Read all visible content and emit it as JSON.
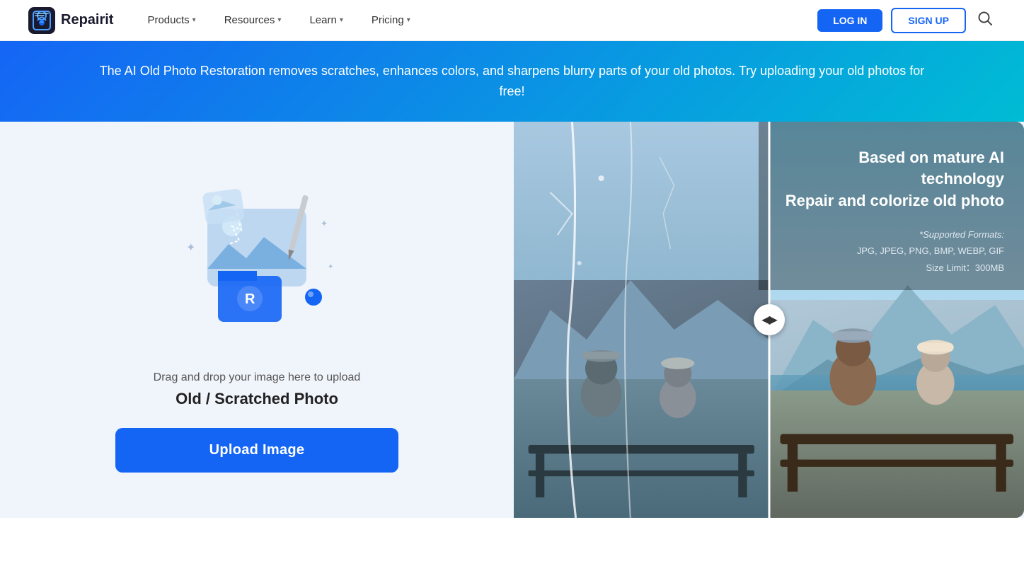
{
  "header": {
    "logo_text": "Repairit",
    "nav_items": [
      {
        "label": "Products",
        "has_dropdown": true
      },
      {
        "label": "Resources",
        "has_dropdown": true
      },
      {
        "label": "Learn",
        "has_dropdown": true
      },
      {
        "label": "Pricing",
        "has_dropdown": true
      }
    ],
    "btn_login": "LOG IN",
    "btn_signup": "SIGN UP"
  },
  "banner": {
    "text": "The AI Old Photo Restoration removes scratches, enhances colors, and sharpens blurry parts of your old photos. Try uploading your old photos for free!"
  },
  "upload_panel": {
    "drag_desc": "Drag and drop your image here to upload",
    "upload_type": "Old / Scratched Photo",
    "btn_label": "Upload Image"
  },
  "preview_panel": {
    "overlay_title": "Based on mature AI technology\nRepair and colorize old photo",
    "formats_label": "*Supported Formats:",
    "formats_list": "JPG, JPEG, PNG, BMP, WEBP, GIF",
    "size_label": "Size Limit：300MB"
  }
}
